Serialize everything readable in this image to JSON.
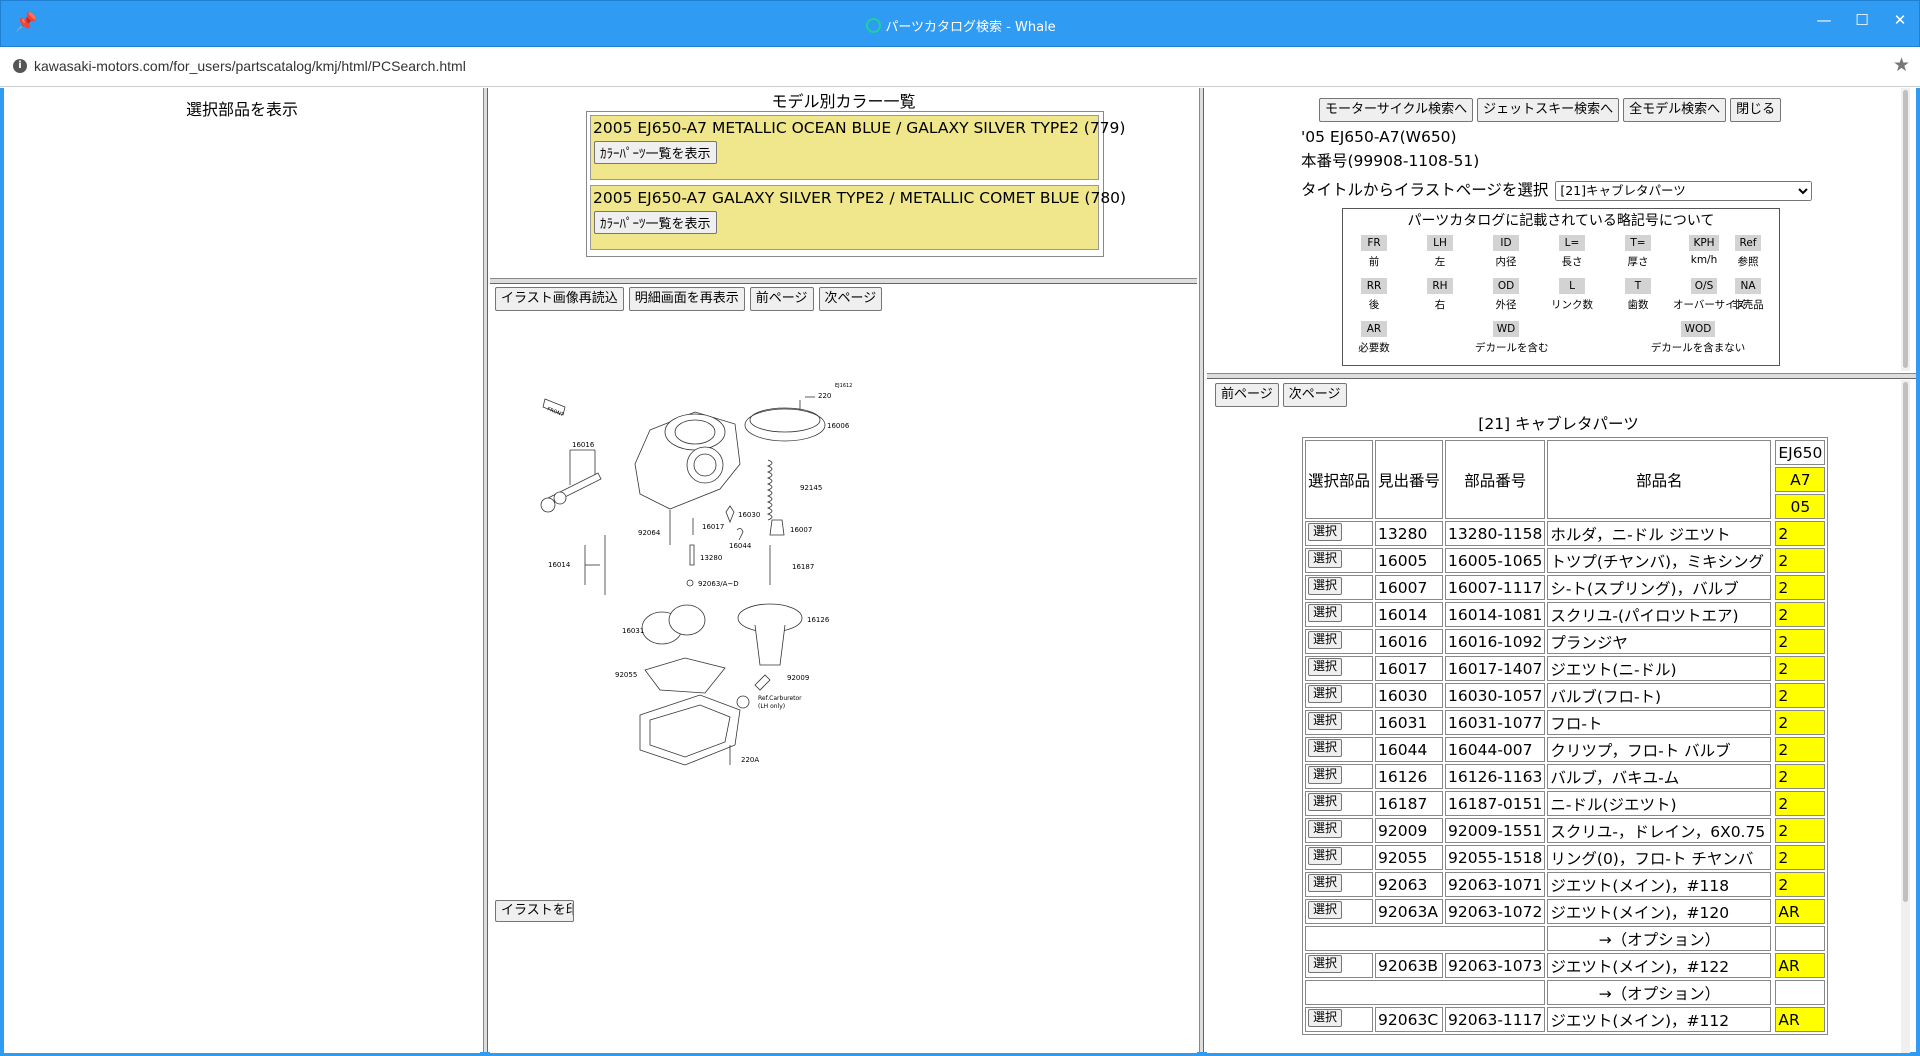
{
  "window": {
    "title": "パーツカタログ検索 - Whale",
    "min": "—",
    "max": "☐",
    "close": "✕"
  },
  "address": {
    "url": "kawasaki-motors.com/for_users/partscatalog/kmj/html/PCSearch.html"
  },
  "left_frame": {
    "show_selected": "選択部品を表示"
  },
  "color_list": {
    "title": "モデル別カラー一覧",
    "button_label": "ｶﾗｰﾊﾟｰﾂ一覧を表示",
    "rows": [
      {
        "text": "2005 EJ650-A7 METALLIC OCEAN BLUE / GALAXY SILVER TYPE2 (779)"
      },
      {
        "text": "2005 EJ650-A7 GALAXY SILVER TYPE2 / METALLIC COMET BLUE (780)"
      }
    ],
    "bg_color": "#f0e68c"
  },
  "illustration": {
    "reload": "イラスト画像再読込",
    "redisplay": "明細画面を再表示",
    "prev": "前ページ",
    "next": "次ページ",
    "cut_button": "イラストを印",
    "labels": {
      "code": "EJ1612",
      "p220": "220",
      "p16006": "16006",
      "p16016": "16016",
      "p92145": "92145",
      "p16030": "16030",
      "p16017": "16017",
      "p16007": "16007",
      "p92064": "92064",
      "p16044": "16044",
      "p13280": "13280",
      "p16014": "16014",
      "p16187": "16187",
      "p92063": "92063/A~D",
      "p16126": "16126",
      "p16031": "16031",
      "p92055": "92055",
      "p92009": "92009",
      "ref1": "Ref.Carburetor",
      "ref2": "(LH only)",
      "p220A": "220A",
      "front": "FRONT"
    }
  },
  "right_top": {
    "buttons": [
      "モーターサイクル検索へ",
      "ジェットスキー検索へ",
      "全モデル検索へ",
      "閉じる"
    ],
    "model": "'05 EJ650-A7(W650)",
    "main_no": "本番号(99908-1108-51)",
    "select_label": "タイトルからイラストページを選択",
    "select_value": "[21]キャブレタパーツ",
    "abbr_title": "パーツカタログに記載されている略記号について",
    "abbr": [
      {
        "code": "FR",
        "mean": "前"
      },
      {
        "code": "LH",
        "mean": "左"
      },
      {
        "code": "ID",
        "mean": "内径"
      },
      {
        "code": "L=",
        "mean": "長さ"
      },
      {
        "code": "T=",
        "mean": "厚さ"
      },
      {
        "code": "KPH",
        "mean": "km/h"
      },
      {
        "code": "Ref",
        "mean": "参照"
      },
      {
        "code": "RR",
        "mean": "後"
      },
      {
        "code": "RH",
        "mean": "右"
      },
      {
        "code": "OD",
        "mean": "外径"
      },
      {
        "code": "L",
        "mean": "リンク数"
      },
      {
        "code": "T",
        "mean": "歯数"
      },
      {
        "code": "O/S",
        "mean": "オーバーサイズ"
      },
      {
        "code": "NA",
        "mean": "非売品"
      },
      {
        "code": "AR",
        "mean": "必要数"
      },
      {
        "code": "WD",
        "mean": "デカールを含む"
      },
      {
        "code": "WOD",
        "mean": "デカールを含まない"
      }
    ]
  },
  "parts": {
    "prev": "前ページ",
    "next": "次ページ",
    "title": "[21] キャブレタパーツ",
    "headers": {
      "select": "選択部品",
      "ref": "見出番号",
      "partno": "部品番号",
      "name": "部品名",
      "model": "EJ650",
      "variant": "A7",
      "year": "05"
    },
    "select_label": "選択",
    "option_text": "→（オプション）",
    "qty_color": "#ffff00",
    "rows": [
      {
        "ref": "13280",
        "partno": "13280-1158",
        "name": "ホルダ，ニ-ドル ジエツト",
        "qty": "2"
      },
      {
        "ref": "16005",
        "partno": "16005-1065",
        "name": "トツプ(チヤンバ)，ミキシング",
        "qty": "2"
      },
      {
        "ref": "16007",
        "partno": "16007-1117",
        "name": "シ-ト(スプリング)，バルブ",
        "qty": "2"
      },
      {
        "ref": "16014",
        "partno": "16014-1081",
        "name": "スクリユ-(パイロツトエア)",
        "qty": "2"
      },
      {
        "ref": "16016",
        "partno": "16016-1092",
        "name": "プランジヤ",
        "qty": "2"
      },
      {
        "ref": "16017",
        "partno": "16017-1407",
        "name": "ジエツト(ニ-ドル)",
        "qty": "2"
      },
      {
        "ref": "16030",
        "partno": "16030-1057",
        "name": "バルブ(フロ-ト)",
        "qty": "2"
      },
      {
        "ref": "16031",
        "partno": "16031-1077",
        "name": "フロ-ト",
        "qty": "2"
      },
      {
        "ref": "16044",
        "partno": "16044-007",
        "name": "クリツプ，フロ-ト バルブ",
        "qty": "2"
      },
      {
        "ref": "16126",
        "partno": "16126-1163",
        "name": "バルブ，バキユ-ム",
        "qty": "2"
      },
      {
        "ref": "16187",
        "partno": "16187-0151",
        "name": "ニ-ドル(ジエツト)",
        "qty": "2"
      },
      {
        "ref": "92009",
        "partno": "92009-1551",
        "name": "スクリユ-，ドレイン，6X0.75",
        "qty": "2"
      },
      {
        "ref": "92055",
        "partno": "92055-1518",
        "name": "リング(0)，フロ-ト チヤンバ",
        "qty": "2"
      },
      {
        "ref": "92063",
        "partno": "92063-1071",
        "name": "ジエツト(メイン)，#118",
        "qty": "2"
      },
      {
        "ref": "92063A",
        "partno": "92063-1072",
        "name": "ジエツト(メイン)，#120",
        "qty": "AR"
      },
      {
        "option": true
      },
      {
        "ref": "92063B",
        "partno": "92063-1073",
        "name": "ジエツト(メイン)，#122",
        "qty": "AR"
      },
      {
        "option": true
      },
      {
        "ref": "92063C",
        "partno": "92063-1117",
        "name": "ジエツト(メイン)，#112",
        "qty": "AR"
      }
    ]
  }
}
